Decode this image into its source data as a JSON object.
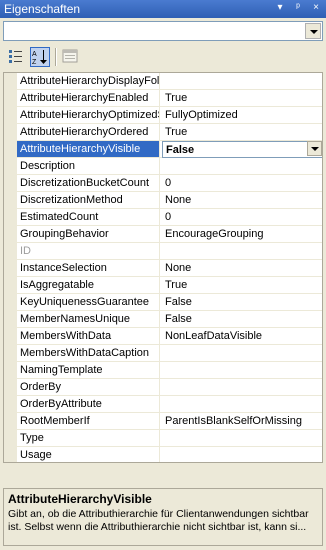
{
  "window": {
    "title": "Eigenschaften",
    "controls": [
      "▾",
      "ᵖ",
      "×"
    ]
  },
  "object_selector": {
    "value": ""
  },
  "toolbar": {
    "categorized_tooltip": "",
    "alphabetical_tooltip": "",
    "pages_tooltip": ""
  },
  "properties": [
    {
      "name": "AttributeHierarchyDisplayFolder",
      "value": ""
    },
    {
      "name": "AttributeHierarchyEnabled",
      "value": "True"
    },
    {
      "name": "AttributeHierarchyOptimizedState",
      "value": "FullyOptimized"
    },
    {
      "name": "AttributeHierarchyOrdered",
      "value": "True"
    },
    {
      "name": "AttributeHierarchyVisible",
      "value": "False",
      "selected": true
    },
    {
      "name": "Description",
      "value": ""
    },
    {
      "name": "DiscretizationBucketCount",
      "value": "0"
    },
    {
      "name": "DiscretizationMethod",
      "value": "None"
    },
    {
      "name": "EstimatedCount",
      "value": "0"
    },
    {
      "name": "GroupingBehavior",
      "value": "EncourageGrouping"
    },
    {
      "name": "ID",
      "value": "",
      "disabled": true
    },
    {
      "name": "InstanceSelection",
      "value": "None"
    },
    {
      "name": "IsAggregatable",
      "value": "True"
    },
    {
      "name": "KeyUniquenessGuarantee",
      "value": "False"
    },
    {
      "name": "MemberNamesUnique",
      "value": "False"
    },
    {
      "name": "MembersWithData",
      "value": "NonLeafDataVisible"
    },
    {
      "name": "MembersWithDataCaption",
      "value": ""
    },
    {
      "name": "NamingTemplate",
      "value": ""
    },
    {
      "name": "OrderBy",
      "value": ""
    },
    {
      "name": "OrderByAttribute",
      "value": ""
    },
    {
      "name": "RootMemberIf",
      "value": "ParentIsBlankSelfOrMissing"
    },
    {
      "name": "Type",
      "value": ""
    },
    {
      "name": "Usage",
      "value": ""
    }
  ],
  "description": {
    "title": "AttributeHierarchyVisible",
    "text": "Gibt an, ob die Attributhierarchie für Clientanwendungen sichtbar ist. Selbst wenn die Attributhierarchie nicht sichtbar ist, kann si..."
  },
  "colors": {
    "selection": "#316ac5",
    "titlebar": "#2f5fb4",
    "chrome": "#ece9d8"
  }
}
